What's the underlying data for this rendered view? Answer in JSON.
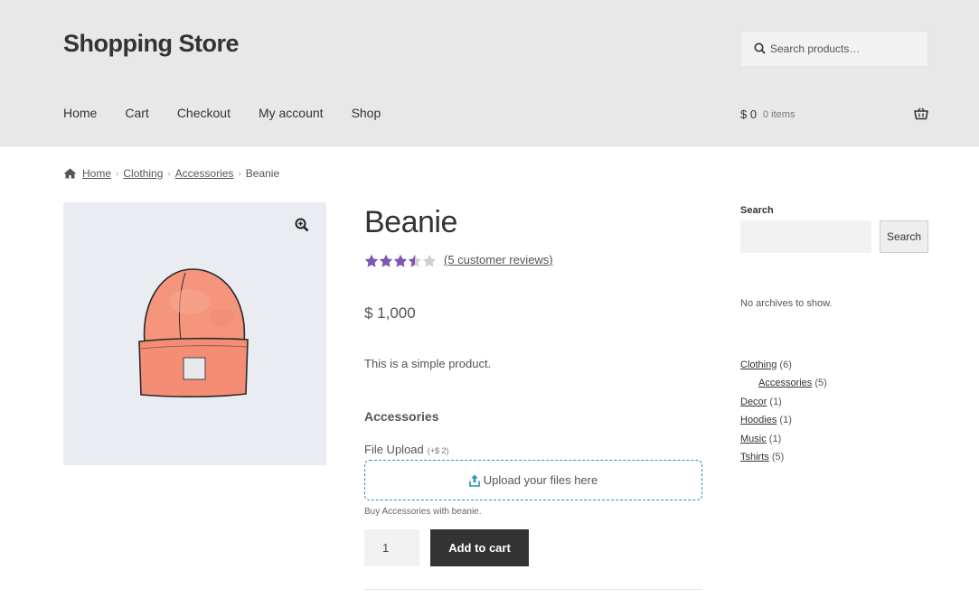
{
  "site": {
    "title": "Shopping Store"
  },
  "search": {
    "placeholder": "Search products…"
  },
  "nav": [
    "Home",
    "Cart",
    "Checkout",
    "My account",
    "Shop"
  ],
  "cart": {
    "total": "$ 0",
    "count": "0 items"
  },
  "breadcrumb": {
    "home": "Home",
    "clothing": "Clothing",
    "accessories": "Accessories",
    "current": "Beanie"
  },
  "product": {
    "title": "Beanie",
    "rating": 3.5,
    "reviews_link": "(5 customer reviews)",
    "price": "$ 1,000",
    "short_description": "This is a simple product.",
    "addon_heading": "Accessories",
    "upload_label": "File Upload",
    "upload_price": "(+$ 2)",
    "upload_zone_text": "Upload your files here",
    "addon_description": "Buy Accessories with beanie.",
    "quantity": "1",
    "add_to_cart_label": "Add to cart"
  },
  "sidebar": {
    "search_title": "Search",
    "search_button": "Search",
    "no_archives": "No archives to show.",
    "categories": [
      {
        "name": "Clothing",
        "count": "(6)"
      },
      {
        "name": "Accessories",
        "count": "(5)"
      },
      {
        "name": "Decor",
        "count": "(1)"
      },
      {
        "name": "Hoodies",
        "count": "(1)"
      },
      {
        "name": "Music",
        "count": "(1)"
      },
      {
        "name": "Tshirts",
        "count": "(5)"
      }
    ]
  },
  "colors": {
    "header_bg": "#e8e8e8",
    "star": "#7f54b3",
    "button": "#333333",
    "upload_border": "#2c8fb5"
  }
}
